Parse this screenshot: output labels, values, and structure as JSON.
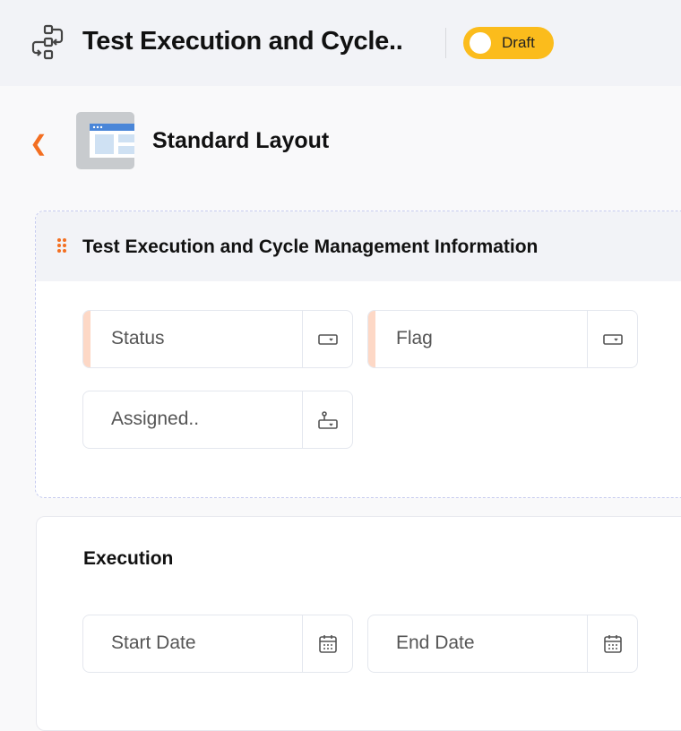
{
  "header": {
    "title": "Test Execution and Cycle..",
    "status_badge": "Draft",
    "badge_color": "#fbbc1c"
  },
  "layout": {
    "back_icon": "chevron-left-icon",
    "name": "Standard Layout"
  },
  "sections": [
    {
      "title": "Test Execution and Cycle Management Information",
      "fields": [
        {
          "label": "Status",
          "icon": "picklist-icon",
          "required": true
        },
        {
          "label": "Flag",
          "icon": "picklist-icon",
          "required": true
        },
        {
          "label": "Assigned..",
          "icon": "user-lookup-icon",
          "required": false
        }
      ]
    },
    {
      "title": "Execution",
      "fields": [
        {
          "label": "Start Date",
          "icon": "calendar-icon",
          "required": false
        },
        {
          "label": "End Date",
          "icon": "calendar-icon",
          "required": false
        }
      ]
    }
  ],
  "accent_color": "#f36f21"
}
